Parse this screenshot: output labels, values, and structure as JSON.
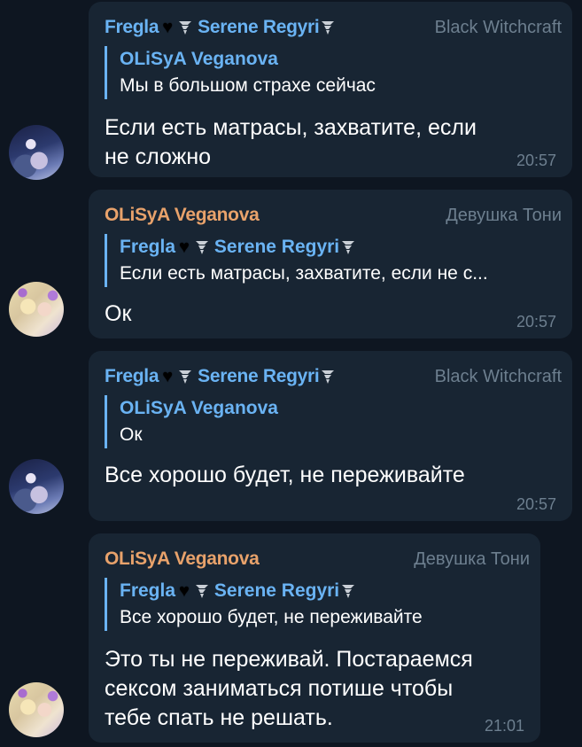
{
  "messages": [
    {
      "sender": "Fregla",
      "sender_suffix": "Serene Regyri",
      "role": "Black Witchcraft",
      "reply": {
        "sender": "OLiSyA Veganova",
        "text": "Мы в большом страхе сейчас"
      },
      "text_line1": "Если есть матрасы, захватите, если",
      "text_line2": "не сложно",
      "time": "20:57"
    },
    {
      "sender": "OLiSyA Veganova",
      "role": "Девушка Тони",
      "reply": {
        "sender": "Fregla",
        "sender_suffix": "Serene Regyri",
        "text": "Если есть матрасы, захватите, если не с..."
      },
      "text_line1": "Ок",
      "time": "20:57"
    },
    {
      "sender": "Fregla",
      "sender_suffix": "Serene Regyri",
      "role": "Black Witchcraft",
      "reply": {
        "sender": "OLiSyA Veganova",
        "text": "Ок"
      },
      "text_line1": "Все хорошо будет, не переживайте",
      "time": "20:57"
    },
    {
      "sender": "OLiSyA Veganova",
      "role": "Девушка Тони",
      "reply": {
        "sender": "Fregla",
        "sender_suffix": "Serene Regyri",
        "text": "Все хорошо будет, не переживайте"
      },
      "text_line1": "Это ты не переживай. Постараемся",
      "text_line2": "сексом заниматься потише чтобы",
      "text_line3": "тебе спать не решать.",
      "time": "21:01"
    }
  ],
  "icons": {
    "heart": "black-heart-icon",
    "tornado": "tornado-icon"
  },
  "colors": {
    "background": "#0e1621",
    "bubble": "#182533",
    "name_blue": "#6ab3f3",
    "name_orange": "#e8a26b",
    "meta_gray": "#6d7f8f"
  }
}
